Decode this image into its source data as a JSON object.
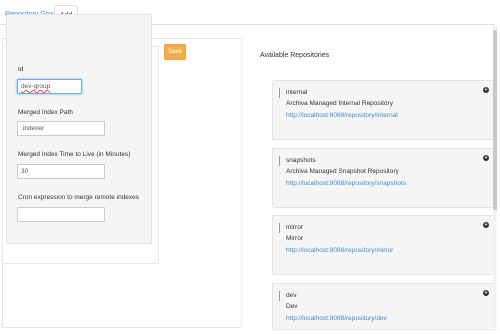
{
  "tabs": [
    {
      "label": "Repository Groups"
    },
    {
      "label": "Add"
    }
  ],
  "form": {
    "id_label": "Id",
    "id_value": "dev-group",
    "merged_index_path_label": "Merged Index Path",
    "merged_index_path_value": ".indexer",
    "ttl_label": "Merged Index Time to Live (in Minutes)",
    "ttl_value": "30",
    "cron_label": "Cron expression to merge remote indexes",
    "cron_value": ""
  },
  "save_label": "Save",
  "available": {
    "title": "Available Repositories",
    "repos": [
      {
        "id": "internal",
        "name": "Archiva Managed Internal Repository",
        "url": "http://localhost:8088/repository/internal"
      },
      {
        "id": "snapshots",
        "name": "Archiva Managed Snapshot Repository",
        "url": "http://localhost:8088/repository/snapshots"
      },
      {
        "id": "mirror",
        "name": "Mirror",
        "url": "http://localhost:8088/repository/mirror"
      },
      {
        "id": "dev",
        "name": "Dev",
        "url": "http://localhost:8088/repository/dev"
      }
    ]
  }
}
